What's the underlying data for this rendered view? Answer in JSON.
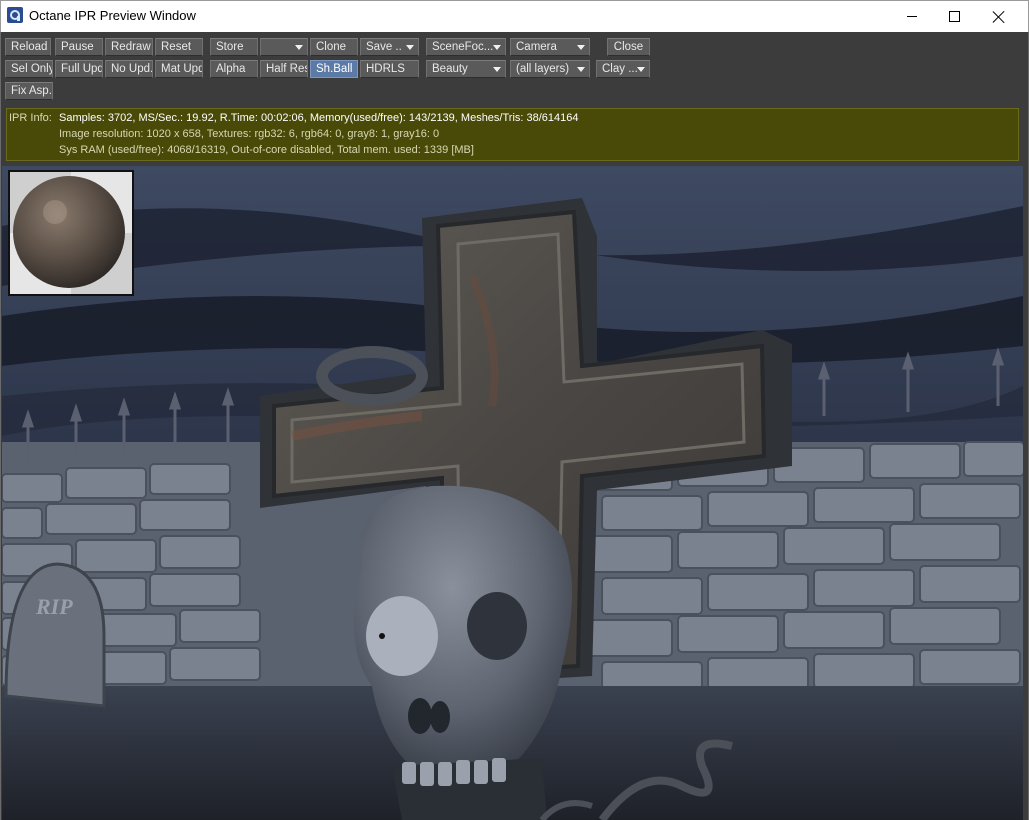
{
  "window": {
    "title": "Octane IPR Preview Window"
  },
  "toolbar": {
    "row1": {
      "reload": "Reload",
      "pause": "Pause",
      "redraw": "Redraw",
      "reset": "Reset",
      "store": "Store",
      "store_slot": "",
      "clone": "Clone",
      "save": "Save ..",
      "scene_focus": "SceneFoc...",
      "camera": "Camera",
      "close": "Close"
    },
    "row2": {
      "sel_only": "Sel Only",
      "full_upd": "Full Upd.",
      "no_upd": "No Upd.",
      "mat_upd": "Mat Upd",
      "alpha": "Alpha",
      "half_res": "Half Res",
      "sh_ball": "Sh.Ball",
      "hdrls": "HDRLS",
      "render_pass": "Beauty",
      "layers": "(all layers)",
      "clay": "Clay ..."
    },
    "row3": {
      "fix_asp": "Fix Asp."
    }
  },
  "ipr_info": {
    "label": "IPR Info:",
    "line1": "Samples: 3702, MS/Sec.: 19.92, R.Time: 00:02:06, Memory(used/free): 143/2139, Meshes/Tris: 38/614164",
    "line2": "Image resolution: 1020 x 658, Textures:  rgb32: 6, rgb64: 0, gray8: 1, gray16: 0",
    "line3": "Sys RAM (used/free): 4068/16319, Out-of-core disabled, Total mem. used: 1339  [MB]"
  },
  "render": {
    "tombstone_text": "RIP"
  },
  "colors": {
    "panel_bg": "#3c3c3c",
    "button_bg": "#5a5a5a",
    "active_button": "#5b7aa6",
    "info_bg": "#4a4a08"
  }
}
